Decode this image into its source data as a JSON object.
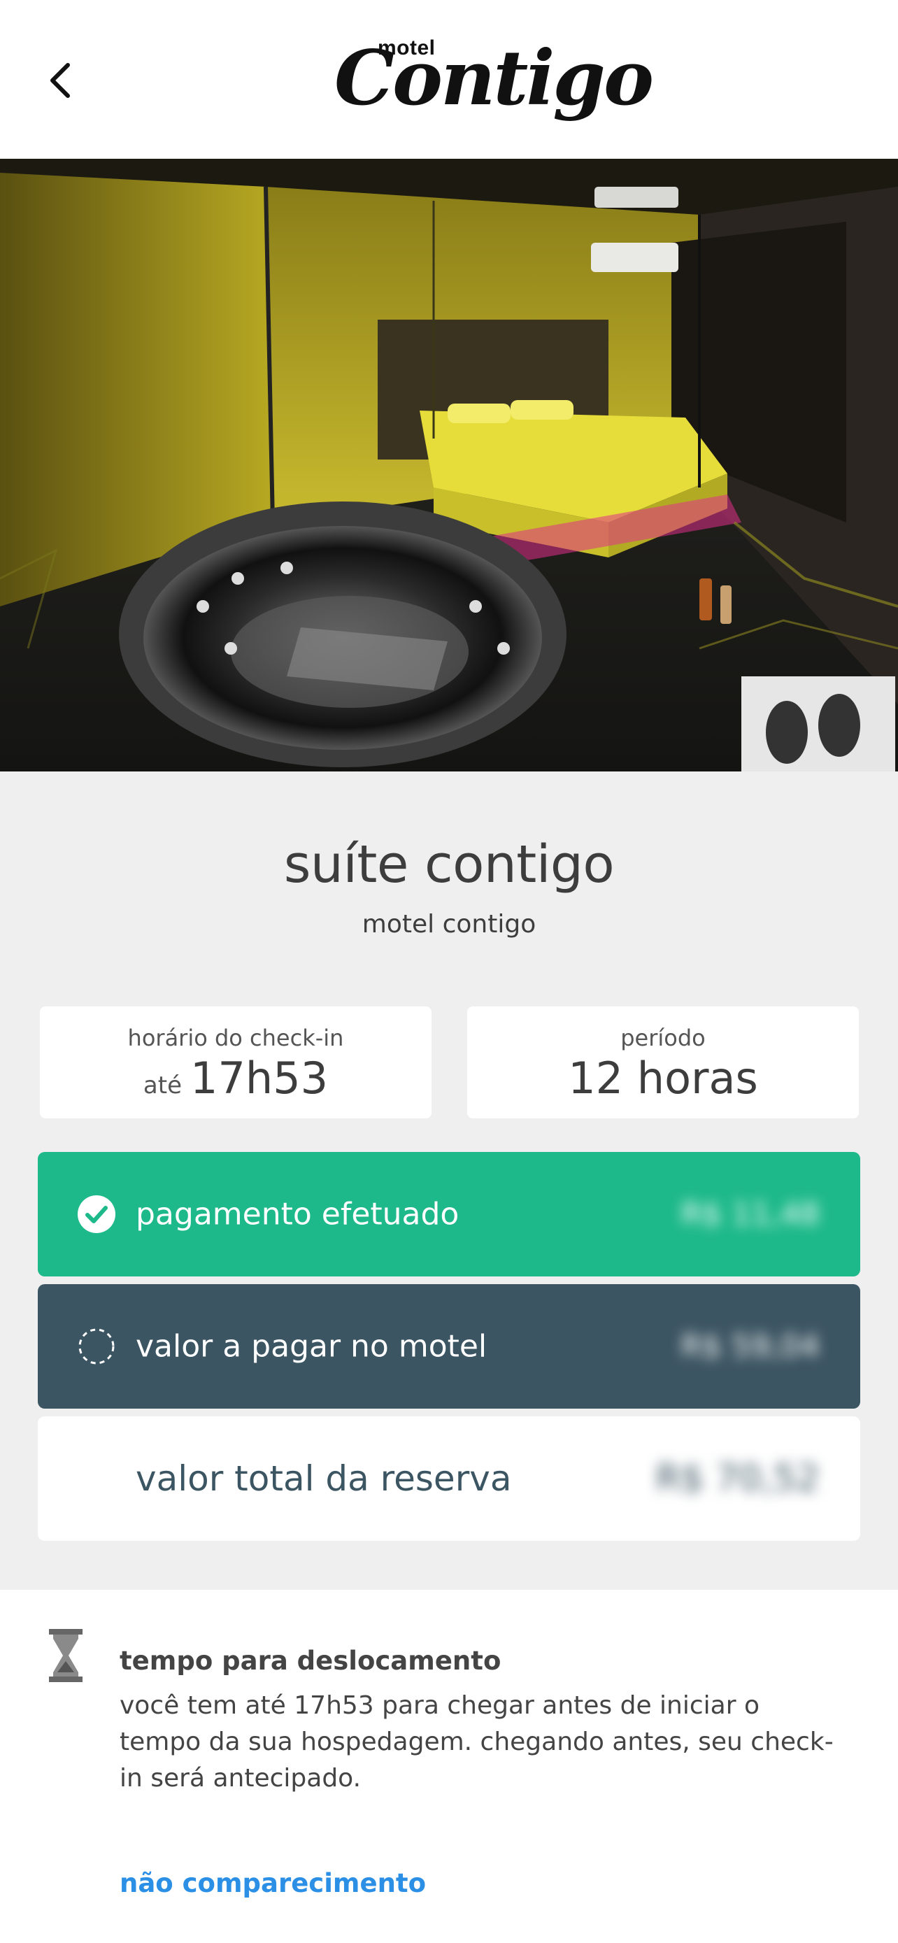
{
  "header": {
    "back_icon": "chevron-left-icon",
    "logo_small": "motel",
    "logo_big": "Contigo"
  },
  "suite": {
    "title": "suíte contigo",
    "motel": "motel contigo"
  },
  "checkin": {
    "label": "horário do check-in",
    "prefix": "até",
    "time": "17h53"
  },
  "period": {
    "label": "período",
    "value": "12 horas"
  },
  "payment": {
    "paid_label": "pagamento efetuado",
    "paid_amount": "R$ 11,48",
    "paid_icon": "check-circle-icon",
    "due_label": "valor a pagar no motel",
    "due_amount": "R$ 59,04",
    "due_icon": "dashed-circle-icon",
    "total_label": "valor total da reserva",
    "total_amount": "R$ 70,52"
  },
  "travel": {
    "icon": "hourglass-icon",
    "title": "tempo para deslocamento",
    "text": "você tem até 17h53 para chegar antes de iniciar o tempo da sua hospedagem. chegando antes, seu check-in será antecipado.",
    "no_show_link": "não comparecimento"
  },
  "colors": {
    "paid": "#1db98a",
    "due": "#3c5562",
    "link": "#2b8fe6",
    "background": "#efefef"
  }
}
